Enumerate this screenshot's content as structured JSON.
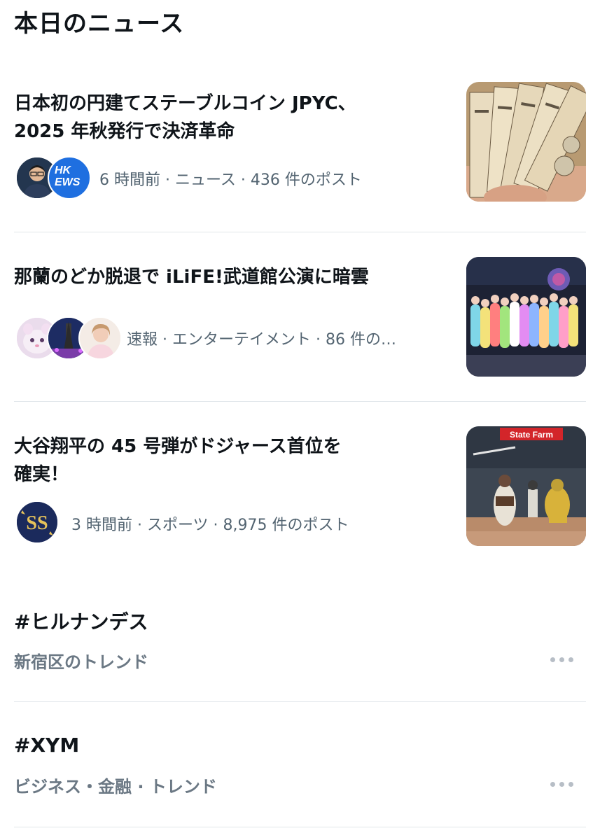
{
  "section": {
    "title": "本日のニュース"
  },
  "news": [
    {
      "title_line1": "日本初の円建てステーブルコイン JPYC、",
      "title_line2": "2025 年秋発行で決済革命",
      "meta": "6 時間前 · ニュース · 436 件のポスト",
      "avatar_badge_line1": "HK",
      "avatar_badge_line2": "EWS",
      "thumb_desc": "banknotes-photo"
    },
    {
      "title_line1": "那蘭のどか脱退で iLiFE!武道館公演に暗雲",
      "title_line2": "",
      "meta": "速報 · エンターテイメント · 86 件の…",
      "thumb_desc": "idol-group-photo"
    },
    {
      "title_line1": "大谷翔平の 45 号弾がドジャース首位を",
      "title_line2": "確実！",
      "meta": "3 時間前 · スポーツ · 8,975 件のポスト",
      "avatar_logo": "S",
      "thumb_desc": "baseball-photo",
      "thumb_banner": "State Farm"
    }
  ],
  "trends": [
    {
      "name": "#ヒルナンデス",
      "meta": "新宿区のトレンド"
    },
    {
      "name": "#XYM",
      "meta": "ビジネス・金融 · トレンド"
    }
  ],
  "colors": {
    "meta": "#536471",
    "divider": "#e1e6ea",
    "text": "#0f1419"
  }
}
